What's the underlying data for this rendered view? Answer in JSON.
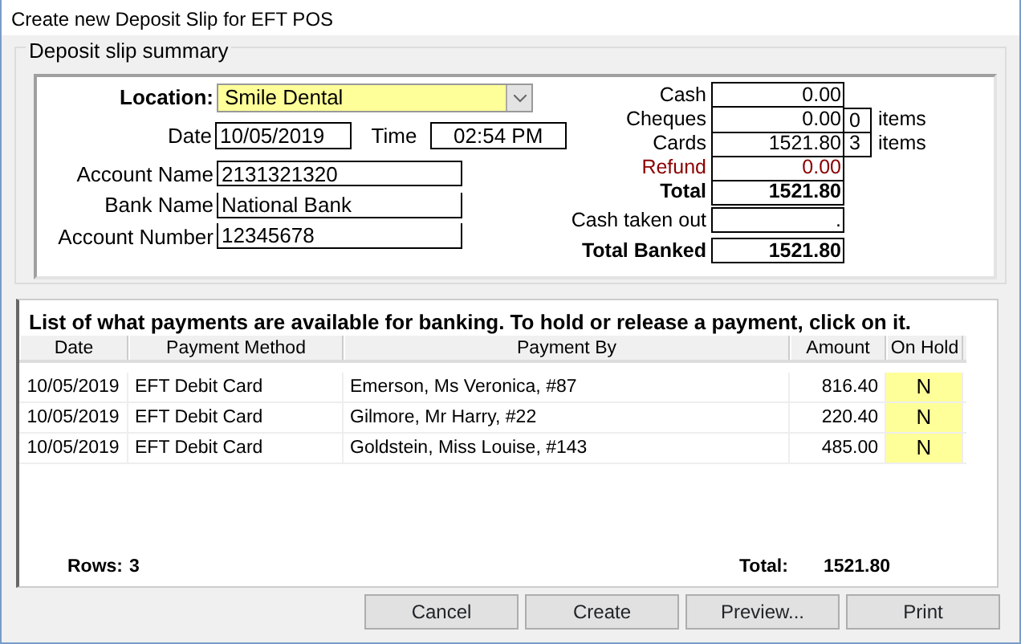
{
  "window": {
    "title": "Create new Deposit Slip for EFT POS"
  },
  "summary": {
    "title": "Deposit slip summary",
    "location": {
      "label": "Location:",
      "value": "Smile Dental"
    },
    "date": {
      "label": "Date",
      "value": "10/05/2019"
    },
    "time": {
      "label": "Time",
      "value": "02:54 PM"
    },
    "account_fields": [
      {
        "label": "Account Name",
        "value": "2131321320"
      },
      {
        "label": "Bank Name",
        "value": "National Bank"
      },
      {
        "label": "Account Number",
        "value": "12345678"
      }
    ],
    "totals": [
      {
        "kind": "plain",
        "label": "Cash",
        "value": "0.00"
      },
      {
        "kind": "count",
        "label": "Cheques",
        "value": "0.00",
        "count": "0",
        "unit": "items"
      },
      {
        "kind": "count",
        "label": "Cards",
        "value": "1521.80",
        "count": "3",
        "unit": "items"
      },
      {
        "kind": "refund",
        "label": "Refund",
        "value": "0.00"
      },
      {
        "kind": "bold",
        "label": "Total",
        "value": "1521.80"
      },
      {
        "kind": "input",
        "label": "Cash taken out",
        "value": "."
      },
      {
        "kind": "bold",
        "label": "Total Banked",
        "value": "1521.80"
      }
    ]
  },
  "payments": {
    "heading": "List of what payments are available for banking. To hold or release a payment, click on it.",
    "columns": [
      "Date",
      "Payment Method",
      "Payment By",
      "Amount",
      "On Hold"
    ],
    "rows": [
      [
        "10/05/2019",
        "EFT Debit Card",
        "Emerson, Ms Veronica, #87",
        "816.40",
        "N"
      ],
      [
        "10/05/2019",
        "EFT Debit Card",
        "Gilmore, Mr Harry, #22",
        "220.40",
        "N"
      ],
      [
        "10/05/2019",
        "EFT Debit Card",
        "Goldstein, Miss Louise, #143",
        "485.00",
        "N"
      ]
    ],
    "rows_label": "Rows:",
    "rows_count": "3",
    "total_label": "Total:",
    "total_value": "1521.80"
  },
  "buttons": [
    "Cancel",
    "Create",
    "Preview...",
    "Print"
  ]
}
